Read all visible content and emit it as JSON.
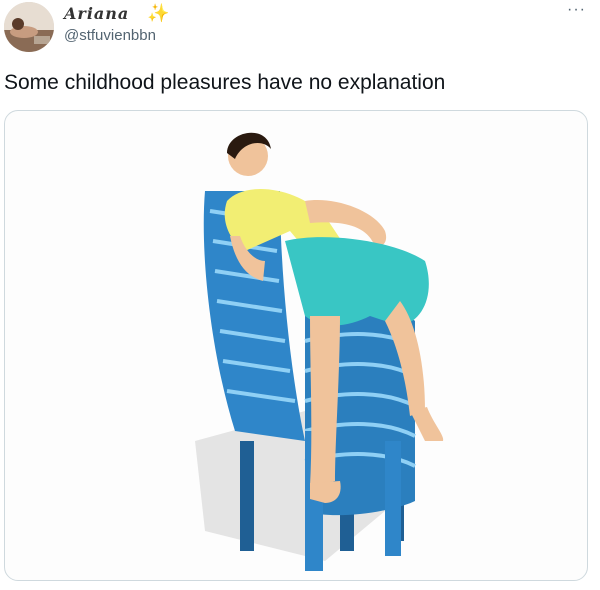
{
  "tweet": {
    "display_name": "Ariana",
    "display_name_emoji": "✨",
    "handle": "@stfuvienbbn",
    "more_label": "···",
    "text": "Some childhood pleasures have no explanation"
  },
  "media": {
    "description_icon": "stacked-chair-illustration"
  },
  "colors": {
    "chair": "#2f86c9",
    "shirt": "#f2ee73",
    "shorts": "#39c6c4",
    "handle": "#536471"
  }
}
